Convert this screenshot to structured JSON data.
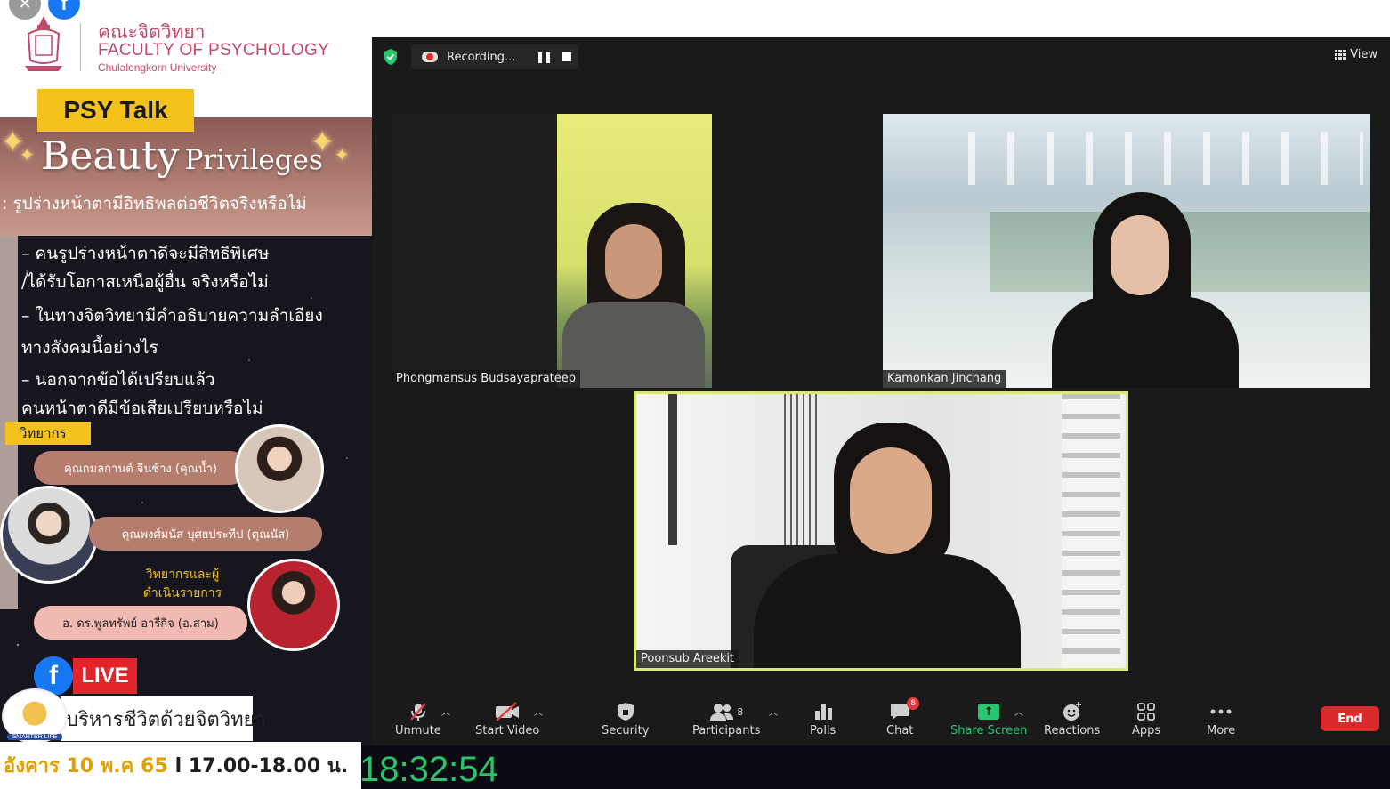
{
  "poster": {
    "faculty_thai": "คณะจิตวิทยา",
    "faculty_en": "FACULTY OF PSYCHOLOGY",
    "university": "Chulalongkorn University",
    "series_tag": "PSY Talk",
    "title_big": "Beauty",
    "title_small": "Privileges",
    "subtitle": ": รูปร่างหน้าตามีอิทธิพลต่อชีวิตจริงหรือไม่",
    "bullets": [
      "– คนรูปร่างหน้าตาดีจะมีสิทธิพิเศษ",
      "/ได้รับโอกาสเหนือผู้อื่น จริงหรือไม่",
      "– ในทางจิตวิทยามีคำอธิบายความลำเอียง",
      "ทางสังคมนี้อย่างไร",
      "– นอกจากข้อได้เปรียบแล้ว",
      "คนหน้าตาดีมีข้อเสียเปรียบหรือไม่"
    ],
    "speaker_tag": "วิทยากร",
    "speaker_1": "คุณกมลกานต์ จีนช้าง (คุณน้ำ)",
    "speaker_2": "คุณพงศ์มนัส บุศยประทีป (คุณนัส)",
    "moderator_label": "วิทยากรและผู้ดำเนินรายการ",
    "speaker_3": "อ. ดร.พูลทรัพย์ อารีกิจ (อ.สาม)",
    "live_label": "LIVE",
    "program_name": "บริหารชีวิตด้วยจิตวิทยา",
    "smarter_life": "SMARTER LIFE",
    "date_text": "อังคาร 10 พ.ค 65",
    "time_text": "l 17.00-18.00 น.",
    "clock": "18:32:54"
  },
  "zoom": {
    "recording_label": "Recording...",
    "pause_symbol": "❚❚",
    "view_label": "View",
    "participants": [
      {
        "name": "Phongmansus Budsayaprateep"
      },
      {
        "name": "Kamonkan Jinchang"
      },
      {
        "name": "Poonsub Areekit"
      }
    ],
    "toolbar": {
      "unmute": "Unmute",
      "start_video": "Start Video",
      "security": "Security",
      "participants": "Participants",
      "participants_count": "8",
      "polls": "Polls",
      "chat": "Chat",
      "chat_badge": "8",
      "share_screen": "Share Screen",
      "reactions": "Reactions",
      "apps": "Apps",
      "more": "More",
      "end": "End"
    }
  },
  "colors": {
    "share_green": "#27c770",
    "end_red": "#d92b2b",
    "active_speaker_border": "#dbe874",
    "psy_yellow": "#f5c21c",
    "faculty_pink": "#c2496a"
  }
}
